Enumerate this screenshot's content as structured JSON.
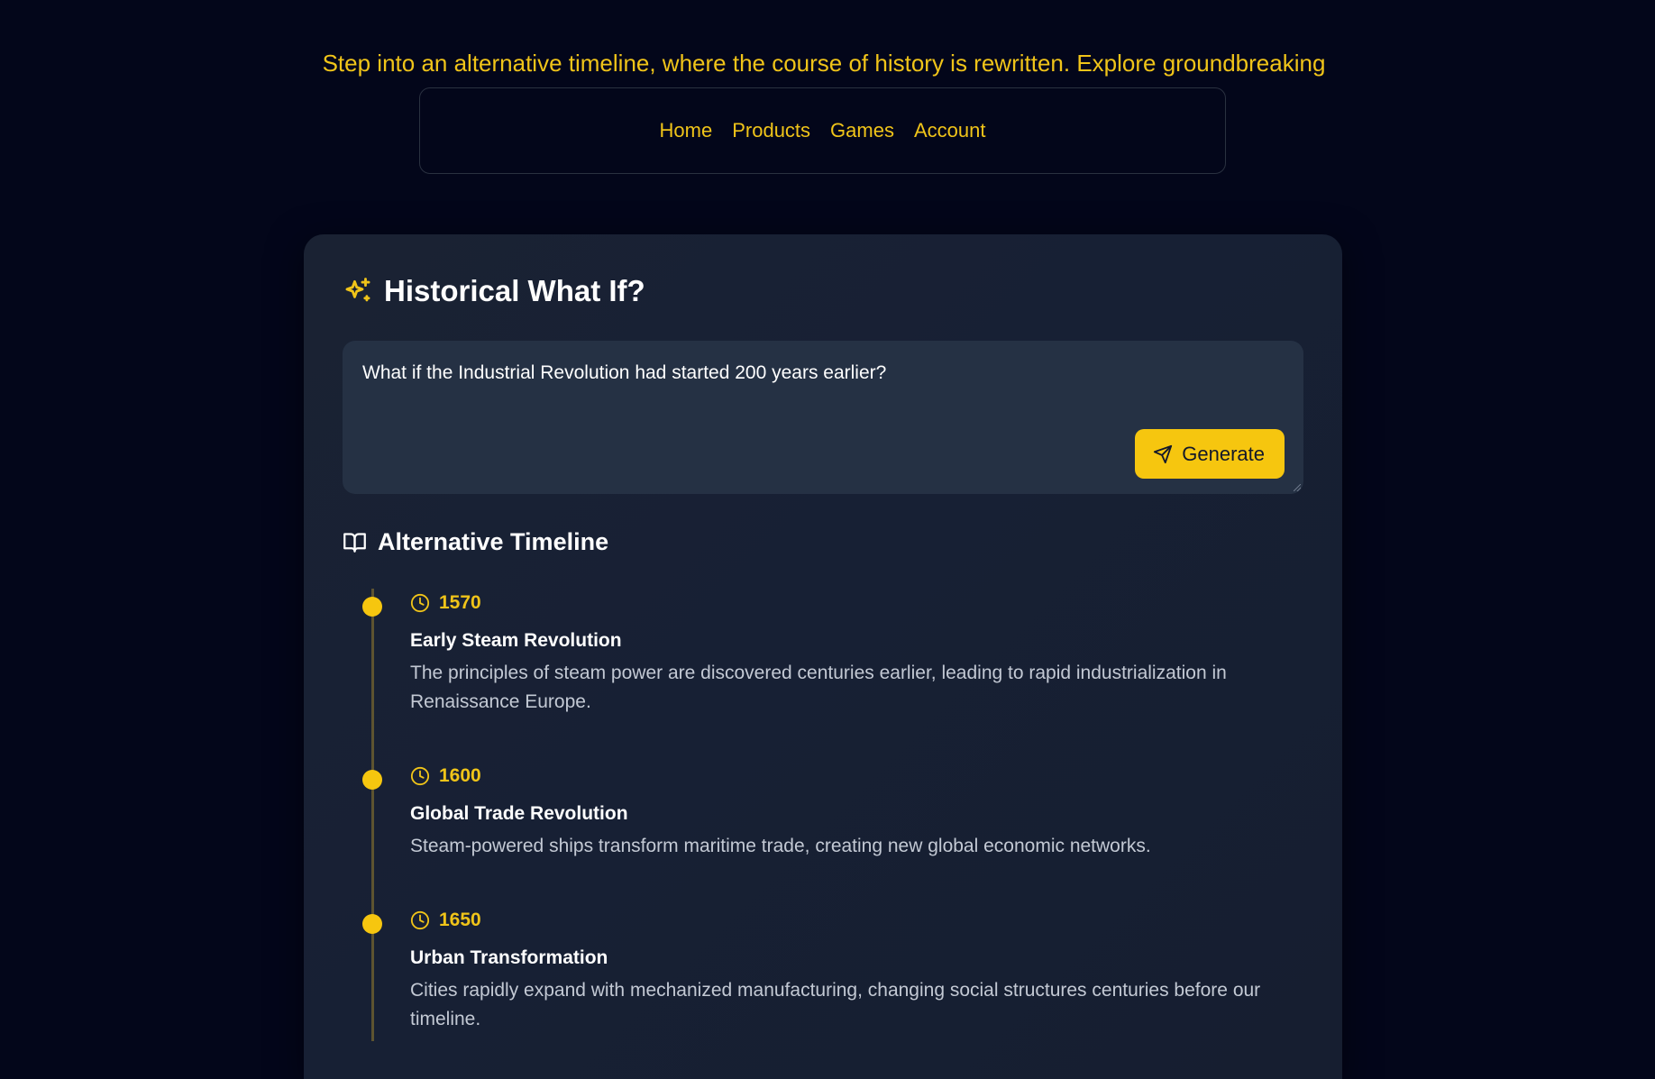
{
  "intro": {
    "text": "Step into an alternative timeline, where the course of history is rewritten. Explore groundbreaking inventions, unexpected alliances, and world-changing events that challenge"
  },
  "nav": {
    "items": [
      "Home",
      "Products",
      "Games",
      "Account"
    ]
  },
  "card": {
    "title": "Historical What If?",
    "title_icon": "sparkles-icon",
    "prompt": {
      "value": "What if the Industrial Revolution had started 200 years earlier?"
    },
    "generate_label": "Generate",
    "generate_icon": "send-icon"
  },
  "timeline": {
    "title": "Alternative Timeline",
    "title_icon": "book-open-icon",
    "events": [
      {
        "year": "1570",
        "title": "Early Steam Revolution",
        "description": "The principles of steam power are discovered centuries earlier, leading to rapid industrialization in Renaissance Europe."
      },
      {
        "year": "1600",
        "title": "Global Trade Revolution",
        "description": "Steam-powered ships transform maritime trade, creating new global economic networks."
      },
      {
        "year": "1650",
        "title": "Urban Transformation",
        "description": "Cities rapidly expand with mechanized manufacturing, changing social structures centuries before our timeline."
      }
    ]
  },
  "colors": {
    "background": "#03061a",
    "accent": "#f6c60f",
    "card": "#1a2233",
    "input": "#253144"
  }
}
